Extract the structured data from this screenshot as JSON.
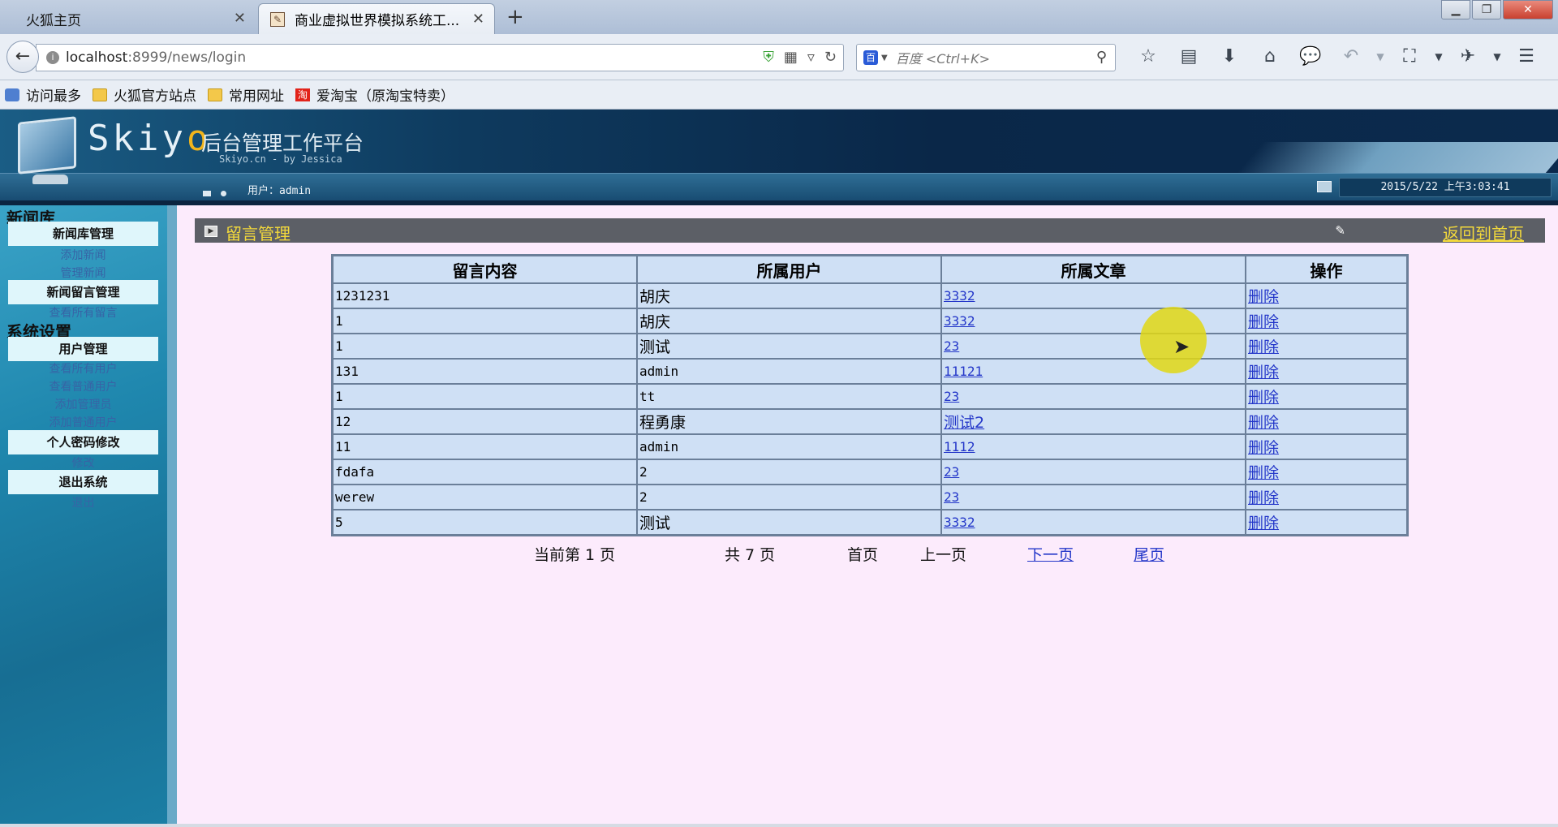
{
  "browser": {
    "tabs": [
      {
        "label": "火狐主页",
        "active": false
      },
      {
        "label": "商业虚拟世界模拟系统工...",
        "active": true
      }
    ],
    "url_host": "localhost",
    "url_rest": ":8999/news/login",
    "search_placeholder": "百度 <Ctrl+K>",
    "bookmarks": [
      "访问最多",
      "火狐官方站点",
      "常用网址",
      "爱淘宝（原淘宝特卖）"
    ],
    "search_engine_glyph": "百",
    "taobao_glyph": "淘"
  },
  "header": {
    "logo": "Skiyo",
    "logo_subtitle": "后台管理工作平台",
    "logo_credit": "Skiyo.cn - by Jessica",
    "user_label": "用户：admin",
    "clock": "2015/5/22 上午3:03:41"
  },
  "sidebar": {
    "section1": "新闻库",
    "news_manage": "新闻库管理",
    "add_news": "添加新闻",
    "manage_news": "管理新闻",
    "comment_manage": "新闻留言管理",
    "view_comments": "查看所有留言",
    "section2": "系统设置",
    "user_manage": "用户管理",
    "view_all_users": "查看所有用户",
    "view_normal_users": "查看普通用户",
    "add_admin": "添加管理员",
    "add_normal_user": "添加普通用户",
    "password": "个人密码修改",
    "modify": "修改",
    "exit_system": "退出系统",
    "exit": "退出"
  },
  "main": {
    "title": "留言管理",
    "back_home": "返回到首页",
    "columns": [
      "留言内容",
      "所属用户",
      "所属文章",
      "操作"
    ],
    "rows": [
      {
        "content": "1231231",
        "user": "胡庆",
        "article": "3332",
        "action": "删除"
      },
      {
        "content": "1",
        "user": "胡庆",
        "article": "3332",
        "action": "删除"
      },
      {
        "content": "1",
        "user": "测试",
        "article": "23",
        "action": "删除"
      },
      {
        "content": "131",
        "user": "admin",
        "article": "11121",
        "action": "删除"
      },
      {
        "content": "1",
        "user": "tt",
        "article": "23",
        "action": "删除"
      },
      {
        "content": "12",
        "user": "程勇康",
        "article": "测试2",
        "action": "删除"
      },
      {
        "content": "11",
        "user": "admin",
        "article": "1112",
        "action": "删除"
      },
      {
        "content": "fdafa",
        "user": "2",
        "article": "23",
        "action": "删除"
      },
      {
        "content": "werew",
        "user": "2",
        "article": "23",
        "action": "删除"
      },
      {
        "content": "5",
        "user": "测试",
        "article": "3332",
        "action": "删除"
      }
    ],
    "pager": {
      "current": "当前第 1 页",
      "total": "共 7 页",
      "first": "首页",
      "prev": "上一页",
      "next": "下一页",
      "last": "尾页"
    }
  },
  "colors": {
    "page_bg": "#fcebfc",
    "title_text": "#f3d93b",
    "link": "#2437c9",
    "table_cell": "#cfe0f5"
  }
}
